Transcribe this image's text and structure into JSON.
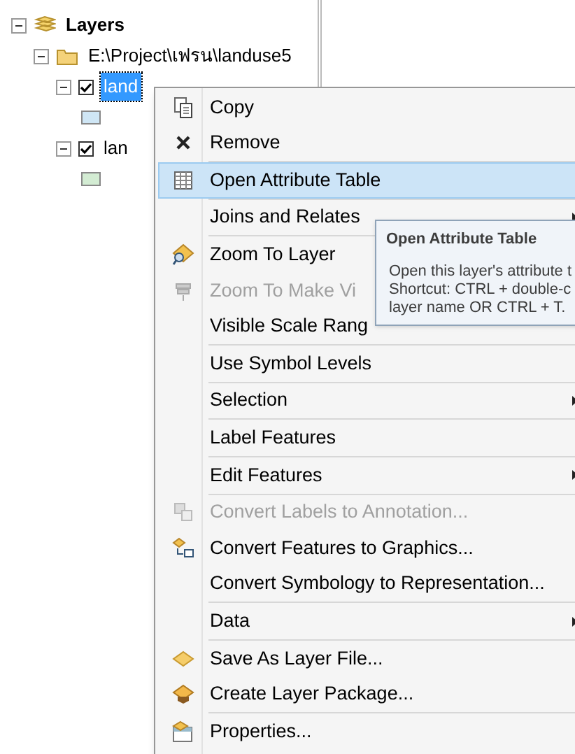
{
  "tree": [
    {
      "label": "Layers",
      "kind": "layers",
      "expanded": true,
      "children": [
        {
          "label": "E:\\Project\\เฟรน\\landuse5",
          "kind": "folder",
          "expanded": true,
          "children": [
            {
              "label": "land",
              "kind": "layer",
              "expanded": true,
              "checked": true,
              "selected": true,
              "children": [
                {
                  "kind": "symbol",
                  "color": "#cfe6f5"
                }
              ]
            },
            {
              "label": "lan",
              "kind": "layer",
              "expanded": true,
              "checked": true,
              "selected": false,
              "children": [
                {
                  "kind": "symbol",
                  "color": "#d3ecd3"
                }
              ]
            }
          ]
        }
      ]
    }
  ],
  "menu": {
    "groups": [
      [
        {
          "label": "Copy",
          "kind": "copy",
          "disabled": false,
          "selected": false,
          "submenu": false
        },
        {
          "label": "Remove",
          "kind": "remove",
          "disabled": false,
          "selected": false,
          "submenu": false
        }
      ],
      [
        {
          "label": "Open Attribute Table",
          "kind": "table",
          "disabled": false,
          "selected": true,
          "submenu": false
        }
      ],
      [
        {
          "label": "Joins and Relates",
          "kind": "plain",
          "disabled": false,
          "selected": false,
          "submenu": true
        }
      ],
      [
        {
          "label": "Zoom To Layer",
          "kind": "zoom",
          "disabled": false,
          "selected": false,
          "submenu": false
        },
        {
          "label": "Zoom To Make Vi",
          "kind": "visible",
          "disabled": true,
          "selected": false,
          "submenu": false
        },
        {
          "label": "Visible Scale Rang",
          "kind": "plain",
          "disabled": false,
          "selected": false,
          "submenu": false
        }
      ],
      [
        {
          "label": "Use Symbol Levels",
          "kind": "plain",
          "disabled": false,
          "selected": false,
          "submenu": false
        }
      ],
      [
        {
          "label": "Selection",
          "kind": "plain",
          "disabled": false,
          "selected": false,
          "submenu": true
        }
      ],
      [
        {
          "label": "Label Features",
          "kind": "plain",
          "disabled": false,
          "selected": false,
          "submenu": false
        }
      ],
      [
        {
          "label": "Edit Features",
          "kind": "plain",
          "disabled": false,
          "selected": false,
          "submenu": true
        }
      ],
      [
        {
          "label": "Convert Labels to Annotation...",
          "kind": "annotation",
          "disabled": true,
          "selected": false,
          "submenu": false
        },
        {
          "label": "Convert Features to Graphics...",
          "kind": "graphics",
          "disabled": false,
          "selected": false,
          "submenu": false
        },
        {
          "label": "Convert Symbology to Representation...",
          "kind": "plain",
          "disabled": false,
          "selected": false,
          "submenu": false
        }
      ],
      [
        {
          "label": "Data",
          "kind": "plain",
          "disabled": false,
          "selected": false,
          "submenu": true
        }
      ],
      [
        {
          "label": "Save As Layer File...",
          "kind": "save",
          "disabled": false,
          "selected": false,
          "submenu": false
        },
        {
          "label": "Create Layer Package...",
          "kind": "package",
          "disabled": false,
          "selected": false,
          "submenu": false
        }
      ],
      [
        {
          "label": "Properties...",
          "kind": "properties",
          "disabled": false,
          "selected": false,
          "submenu": false
        }
      ]
    ]
  },
  "tooltip": {
    "title": "Open Attribute Table",
    "lines": [
      "Open this layer's attribute t",
      "Shortcut: CTRL + double-c",
      "layer name OR CTRL + T."
    ]
  }
}
